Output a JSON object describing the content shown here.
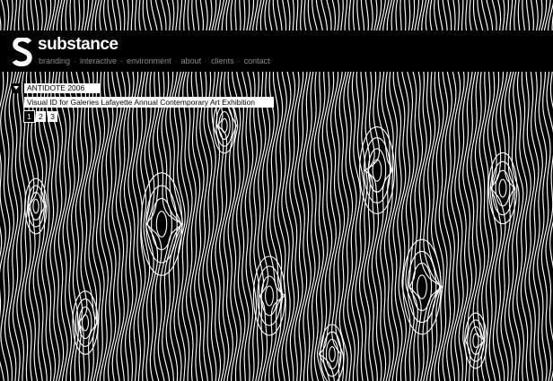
{
  "brand": {
    "name": "substance",
    "logo_icon": "s-logo-icon"
  },
  "nav": {
    "items": [
      {
        "label": "branding"
      },
      {
        "label": "interactive"
      },
      {
        "label": "environment"
      },
      {
        "label": "about"
      },
      {
        "label": "clients"
      },
      {
        "label": "contact"
      }
    ],
    "separator": "·"
  },
  "project": {
    "collapse_icon": "triangle-down-icon",
    "title": "ANTIDOTE 2006",
    "subtitle": "Visual ID for Galeries Lafayette Annual Contemporary Art Exhibition",
    "pages": [
      "1",
      "2",
      "3"
    ],
    "active_page": "1"
  },
  "colors": {
    "background": "#000000",
    "foreground": "#ffffff",
    "nav_text": "#8a8a8a"
  }
}
